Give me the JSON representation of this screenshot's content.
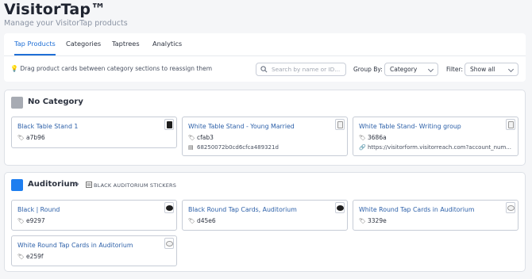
{
  "app": {
    "title": "VisitorTap™",
    "subtitle": "Manage your VisitorTap products"
  },
  "tabs": [
    {
      "label": "Tap Products",
      "active": true
    },
    {
      "label": "Categories",
      "active": false
    },
    {
      "label": "Taptrees",
      "active": false
    },
    {
      "label": "Analytics",
      "active": false
    }
  ],
  "toolbar": {
    "hint": "Drag product cards between category sections to reassign them",
    "search_placeholder": "Search by name or ID...",
    "group_by_label": "Group By:",
    "group_by_value": "Category",
    "filter_label": "Filter:",
    "filter_value": "Show all"
  },
  "sections": [
    {
      "name": "No Category",
      "color": "#a7abb3",
      "cards": [
        {
          "title": "Black Table Stand 1",
          "id": "a7b96",
          "thumb": "black-stand"
        },
        {
          "title": "White Table Stand - Young Married",
          "id": "cfab3",
          "extra": "68250072b0cd6cfca489321d",
          "thumb": "white-stand"
        },
        {
          "title": "White Table Stand- Writing group",
          "id": "3686a",
          "link": "https://visitorform.visitorreach.com?account_num...",
          "thumb": "white-stand"
        }
      ]
    },
    {
      "name": "Auditorium",
      "color": "#1e7ef0",
      "subcategory": "BLACK AUDITORIUM STICKERS",
      "cards": [
        {
          "title": "Black | Round",
          "id": "e9297",
          "thumb": "black-round"
        },
        {
          "title": "Black Round Tap Cards, Auditorium",
          "id": "d45e6",
          "thumb": "black-round"
        },
        {
          "title": "White Round Tap Cards in Auditorium",
          "id": "3329e",
          "thumb": "white-round"
        },
        {
          "title": "White Round Tap Cards in Auditorium",
          "id": "e259f",
          "thumb": "white-round"
        }
      ]
    }
  ]
}
